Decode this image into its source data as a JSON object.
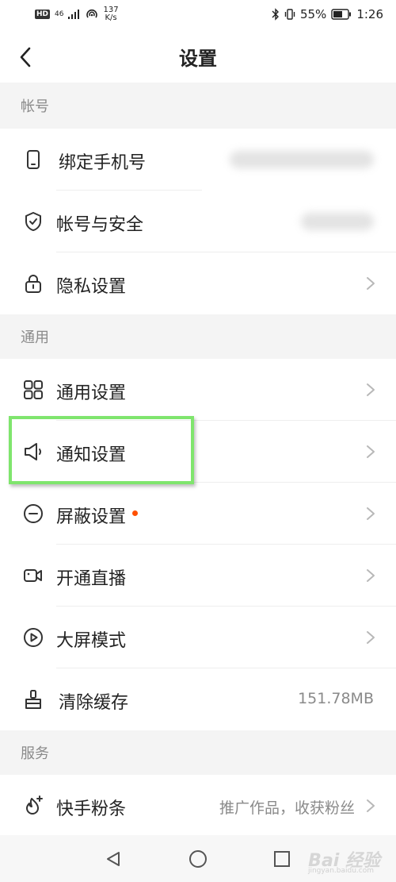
{
  "status_bar": {
    "hd": "HD",
    "network": "46",
    "speed_value": "137",
    "speed_unit": "K/s",
    "battery_percent": "55%",
    "time": "1:26"
  },
  "header": {
    "title": "设置",
    "back_icon": "chevron-left-icon"
  },
  "sections": {
    "account": {
      "title": "帐号",
      "items": [
        {
          "label": "绑定手机号",
          "icon": "phone-icon"
        },
        {
          "label": "帐号与安全",
          "icon": "shield-icon"
        },
        {
          "label": "隐私设置",
          "icon": "lock-icon"
        }
      ]
    },
    "general": {
      "title": "通用",
      "items": [
        {
          "label": "通用设置",
          "icon": "grid-icon"
        },
        {
          "label": "通知设置",
          "icon": "speaker-icon"
        },
        {
          "label": "屏蔽设置",
          "icon": "block-icon"
        },
        {
          "label": "开通直播",
          "icon": "video-camera-icon"
        },
        {
          "label": "大屏模式",
          "icon": "play-icon"
        },
        {
          "label": "清除缓存",
          "icon": "broom-icon",
          "value": "151.78MB"
        }
      ]
    },
    "service": {
      "title": "服务",
      "items": [
        {
          "label": "快手粉条",
          "icon": "fire-plus-icon",
          "value": "推广作品，收获粉丝"
        }
      ]
    }
  },
  "watermark": {
    "text": "Bai 经验",
    "sub": "jingyan.baidu.com"
  },
  "colors": {
    "accent_dot": "#ff5000",
    "highlight_border": "#7fe56d",
    "section_bg": "#f4f4f4"
  }
}
